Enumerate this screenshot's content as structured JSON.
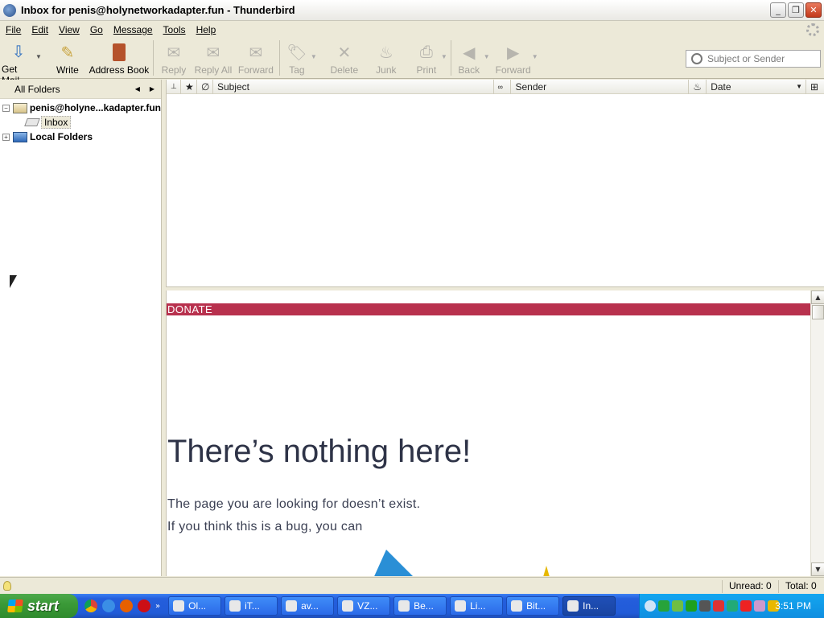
{
  "window": {
    "title": "Inbox for penis@holynetworkadapter.fun - Thunderbird"
  },
  "menu": [
    "File",
    "Edit",
    "View",
    "Go",
    "Message",
    "Tools",
    "Help"
  ],
  "toolbar": {
    "get_mail": "Get Mail",
    "write": "Write",
    "address_book": "Address Book",
    "reply": "Reply",
    "reply_all": "Reply All",
    "forward": "Forward",
    "tag": "Tag",
    "delete": "Delete",
    "junk": "Junk",
    "print": "Print",
    "back": "Back",
    "forward_nav": "Forward"
  },
  "search": {
    "placeholder": "Subject or Sender"
  },
  "folders": {
    "header": "All Folders",
    "account": "penis@holyne...kadapter.fun",
    "inbox": "Inbox",
    "local": "Local Folders"
  },
  "columns": {
    "subject": "Subject",
    "sender": "Sender",
    "date": "Date"
  },
  "message": {
    "donate": "DONATE",
    "heading": "There’s nothing here!",
    "line1": "The page you are looking for doesn’t exist.",
    "line2": "If you think this is a bug, you can"
  },
  "status": {
    "unread": "Unread: 0",
    "total": "Total: 0"
  },
  "taskbar": {
    "start": "start",
    "tasks": [
      "Ol...",
      "iT...",
      "av...",
      "VZ...",
      "Be...",
      "Li...",
      "Bit...",
      "In..."
    ],
    "clock": "3:51 PM"
  }
}
